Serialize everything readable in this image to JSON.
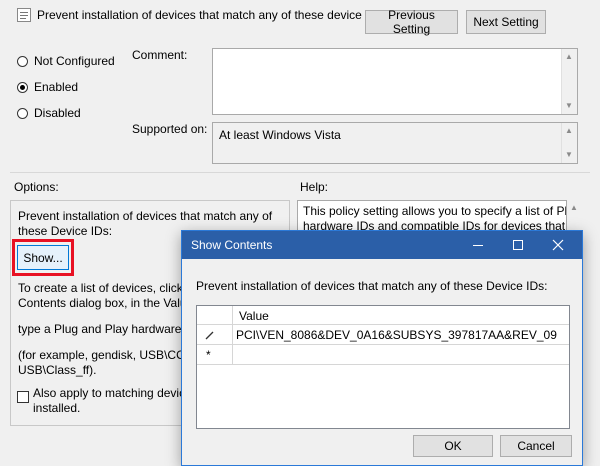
{
  "policy": {
    "title": "Prevent installation of devices that match any of these device IDs",
    "prev_button": "Previous Setting",
    "next_button": "Next Setting",
    "radios": [
      {
        "label": "Not Configured",
        "checked": false
      },
      {
        "label": "Enabled",
        "checked": true
      },
      {
        "label": "Disabled",
        "checked": false
      }
    ],
    "comment_label": "Comment:",
    "supported_label": "Supported on:",
    "supported_value": "At least Windows Vista",
    "options_label": "Options:",
    "help_label": "Help:",
    "options": {
      "desc": "Prevent installation of devices that match any of these Device IDs:",
      "show_button": "Show...",
      "text1": "To create a list of devices, click Sh",
      "text2": "Contents dialog box, in the Value",
      "text3": "type a Plug and Play hardware ID",
      "text4": "(for example, gendisk, USB\\COM",
      "text5": "USB\\Class_ff).",
      "checkbox_label_1": "Also apply to matching device",
      "checkbox_label_2": "installed."
    },
    "help": {
      "line1": "This policy setting allows you to specify a list of Plu",
      "line2": "hardware IDs and compatible IDs for devices that W"
    },
    "highlight_color": "#e81123"
  },
  "dialog": {
    "title": "Show Contents",
    "minimize_icon": "minimize-icon",
    "maximize_icon": "maximize-icon",
    "close_icon": "close-icon",
    "prompt": "Prevent installation of devices that match any of these Device IDs:",
    "column_header": "Value",
    "rows": [
      {
        "marker": "pencil-icon",
        "value": "PCI\\VEN_8086&DEV_0A16&SUBSYS_397817AA&REV_09"
      },
      {
        "marker": "asterisk-icon",
        "value": ""
      }
    ],
    "ok_button": "OK",
    "cancel_button": "Cancel",
    "titlebar_color": "#2b5fa8"
  }
}
